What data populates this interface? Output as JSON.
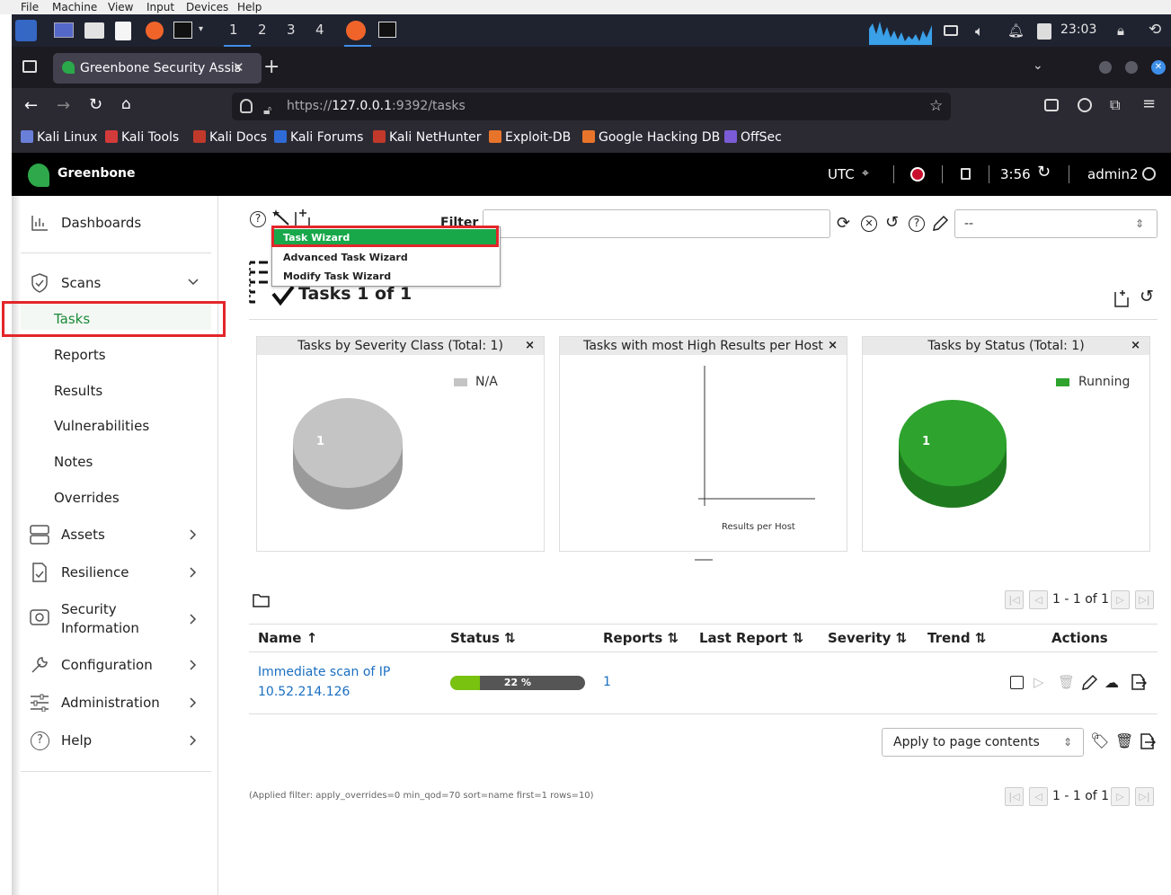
{
  "vm_menu": [
    "File",
    "Machine",
    "View",
    "Input",
    "Devices",
    "Help"
  ],
  "taskbar": {
    "workspaces": [
      "1",
      "2",
      "3",
      "4"
    ],
    "clock": "23:03"
  },
  "browser": {
    "tab_title": "Greenbone Security Assis",
    "url_prefix": "https://",
    "url_host": "127.0.0.1",
    "url_rest": ":9392/tasks",
    "bookmarks": [
      {
        "label": "Kali Linux",
        "color": "#6a7fd8"
      },
      {
        "label": "Kali Tools",
        "color": "#d33b3b"
      },
      {
        "label": "Kali Docs",
        "color": "#c0392b"
      },
      {
        "label": "Kali Forums",
        "color": "#2f6bd6"
      },
      {
        "label": "Kali NetHunter",
        "color": "#c0392b"
      },
      {
        "label": "Exploit-DB",
        "color": "#e8742b"
      },
      {
        "label": "Google Hacking DB",
        "color": "#e8742b"
      },
      {
        "label": "OffSec",
        "color": "#7b5cd6"
      }
    ]
  },
  "header": {
    "brand": "Greenbone",
    "timezone": "UTC",
    "timer": "3:56",
    "user": "admin2"
  },
  "sidebar": {
    "dashboards": "Dashboards",
    "scans": "Scans",
    "scan_items": [
      "Tasks",
      "Reports",
      "Results",
      "Vulnerabilities",
      "Notes",
      "Overrides"
    ],
    "assets": "Assets",
    "resilience": "Resilience",
    "security_info_1": "Security",
    "security_info_2": "Information",
    "configuration": "Configuration",
    "administration": "Administration",
    "help": "Help"
  },
  "toolbar": {
    "filter_label": "Filter",
    "filter_select": "--",
    "wizard_menu": [
      "Task Wizard",
      "Advanced Task Wizard",
      "Modify Task Wizard"
    ]
  },
  "page": {
    "title": "Tasks 1 of 1"
  },
  "charts": {
    "severity": {
      "title": "Tasks by Severity Class (Total: 1)",
      "legend": "N/A",
      "value": "1",
      "color": "#c4c4c4"
    },
    "high_results": {
      "title": "Tasks with most High Results per Host",
      "xlabel": "Results per Host"
    },
    "status": {
      "title": "Tasks by Status (Total: 1)",
      "legend": "Running",
      "value": "1",
      "color": "#2ea32e"
    }
  },
  "chart_data": [
    {
      "type": "pie",
      "title": "Tasks by Severity Class (Total: 1)",
      "categories": [
        "N/A"
      ],
      "values": [
        1
      ],
      "legend": "top-right"
    },
    {
      "type": "bar",
      "title": "Tasks with most High Results per Host",
      "xlabel": "Results per Host",
      "categories": [],
      "values": []
    },
    {
      "type": "pie",
      "title": "Tasks by Status (Total: 1)",
      "categories": [
        "Running"
      ],
      "values": [
        1
      ],
      "legend": "top-right"
    }
  ],
  "table": {
    "columns": [
      "Name",
      "Status",
      "Reports",
      "Last Report",
      "Severity",
      "Trend",
      "Actions"
    ],
    "rows": [
      {
        "name_1": "Immediate scan of IP",
        "name_2": "10.52.214.126",
        "progress_label": "22 %",
        "progress": 0.22,
        "reports": "1"
      }
    ],
    "pager": "1 - 1 of 1",
    "bulk_action": "Apply to page contents",
    "applied_filter": "(Applied filter: apply_overrides=0 min_qod=70 sort=name first=1 rows=10)"
  }
}
